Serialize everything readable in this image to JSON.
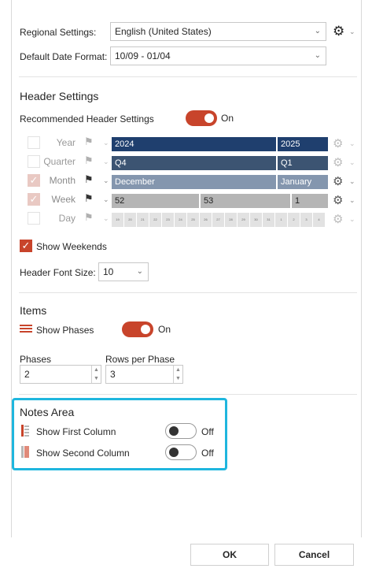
{
  "regional": {
    "label": "Regional Settings:",
    "value": "English (United States)"
  },
  "date_format": {
    "label": "Default Date Format:",
    "value": "10/09 - 01/04"
  },
  "header_settings": {
    "title": "Header Settings",
    "recommended_label": "Recommended Header Settings",
    "recommended_state": "On",
    "rows": [
      {
        "label": "Year",
        "checked": false,
        "cells": [
          "2024",
          "2025"
        ],
        "color": "#1f3f6e"
      },
      {
        "label": "Quarter",
        "checked": false,
        "cells": [
          "Q4",
          "Q1"
        ],
        "color": "#3c5472"
      },
      {
        "label": "Month",
        "checked": true,
        "cells": [
          "December",
          "January"
        ],
        "color": "#8496ae"
      },
      {
        "label": "Week",
        "checked": true,
        "cells": [
          "52",
          "53",
          "1"
        ],
        "color": "#b5b5b5"
      },
      {
        "label": "Day",
        "checked": false,
        "cells": [
          "19",
          "20",
          "21",
          "22",
          "23",
          "24",
          "25",
          "26",
          "27",
          "28",
          "29",
          "30",
          "31",
          "1",
          "2",
          "3",
          "4"
        ],
        "color": "#e2e2e2"
      }
    ],
    "show_weekends": "Show Weekends",
    "font_size_label": "Header Font Size:",
    "font_size_value": "10"
  },
  "items": {
    "title": "Items",
    "show_phases_label": "Show Phases",
    "show_phases_state": "On",
    "phases_label": "Phases",
    "phases_value": "2",
    "rows_per_phase_label": "Rows per Phase",
    "rows_per_phase_value": "3"
  },
  "notes": {
    "title": "Notes Area",
    "first_label": "Show First Column",
    "first_state": "Off",
    "second_label": "Show Second Column",
    "second_state": "Off"
  },
  "footer": {
    "ok": "OK",
    "cancel": "Cancel"
  },
  "colors": {
    "accent": "#c8442b",
    "highlight_box": "#1fb6de"
  }
}
